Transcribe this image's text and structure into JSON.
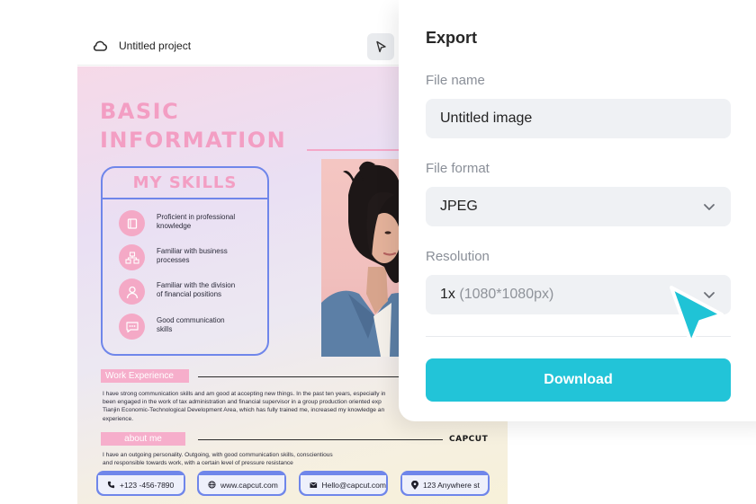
{
  "header": {
    "project_title": "Untitled project",
    "icons": {
      "cloud": "cloud-icon",
      "pointer": "pointer-icon"
    }
  },
  "resume": {
    "title_line1": "BASIC",
    "title_line2": "INFORMATION",
    "skills_title": "MY SKILLS",
    "skills": [
      {
        "text": "Proficient in professional\n knowledge",
        "icon": "book-icon"
      },
      {
        "text": "Familiar with business\n processes",
        "icon": "network-icon"
      },
      {
        "text": "Familiar with the division\nof financial positions",
        "icon": "person-icon"
      },
      {
        "text": "Good communication\n skills",
        "icon": "chat-icon"
      }
    ],
    "work_label": "Work Experience",
    "work_text": "I have strong communication skills and am good at accepting new things. In the past ten years, especially in\nbeen engaged in the work of tax administration and financial supervisor in a group production oriented exp\nTianjin Economic-Technological Development Area, which has fully trained me, increased my knowledge an\nexperience.",
    "about_label": "about  me",
    "about_text": "I have an outgoing personality. Outgoing, with good communication skills, conscientious\nand responsible towards work, with a certain level of pressure resistance",
    "brand": "CAPCUT",
    "contacts": [
      {
        "text": "+123 -456-7890",
        "icon": "phone-icon"
      },
      {
        "text": "www.capcut.com",
        "icon": "globe-icon"
      },
      {
        "text": "Hello@capcut.com",
        "icon": "mail-icon"
      },
      {
        "text": "123 Anywhere st",
        "icon": "location-pin-icon"
      }
    ]
  },
  "export": {
    "title": "Export",
    "file_name_label": "File name",
    "file_name_value": "Untitled image",
    "file_format_label": "File format",
    "file_format_value": "JPEG",
    "resolution_label": "Resolution",
    "resolution_scale": "1x",
    "resolution_detail": "(1080*1080px)",
    "download_label": "Download"
  },
  "colors": {
    "accent": "#22c4d8",
    "pink": "#f39ec3",
    "blue": "#6f86ea"
  }
}
